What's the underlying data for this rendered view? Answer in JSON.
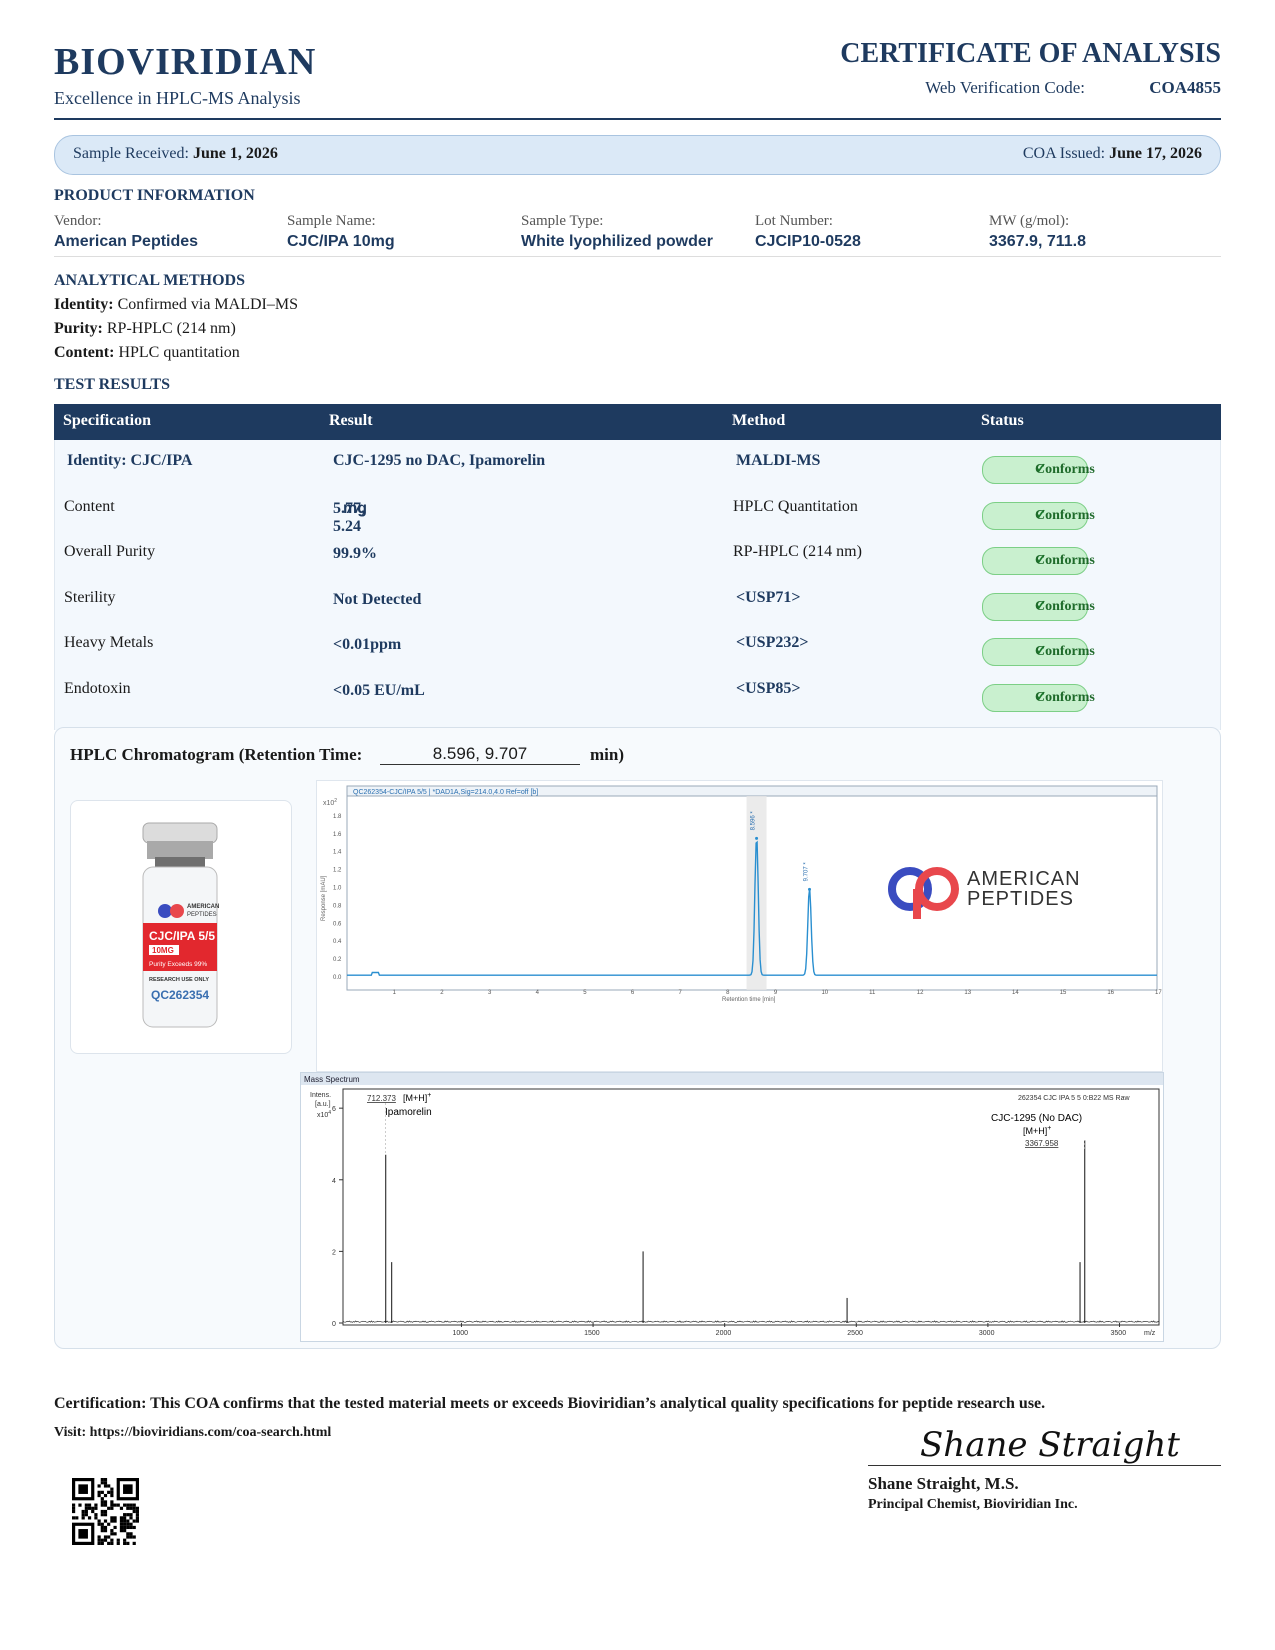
{
  "header": {
    "brand": "BIOVIRIDIAN",
    "tagline": "Excellence in HPLC-MS Analysis",
    "doc_title": "CERTIFICATE OF ANALYSIS",
    "verification_label": "Web Verification Code:",
    "verification_code": "COA4855"
  },
  "dates": {
    "received_label": "Sample Received:",
    "received_value": "June 1, 2026",
    "issued_label": "COA Issued:",
    "issued_value": "June 17, 2026"
  },
  "product": {
    "heading": "PRODUCT INFORMATION",
    "fields": [
      {
        "label": "Vendor:",
        "value": "American Peptides"
      },
      {
        "label": "Sample Name:",
        "value": "CJC/IPA 10mg"
      },
      {
        "label": "Sample Type:",
        "value": "White lyophilized powder"
      },
      {
        "label": "Lot Number:",
        "value": "CJCIP10-0528"
      },
      {
        "label": "MW (g/mol):",
        "value": "3367.9, 711.8"
      }
    ]
  },
  "methods": {
    "heading": "ANALYTICAL METHODS",
    "lines": [
      {
        "label": "Identity:",
        "value": "Confirmed via MALDI–MS"
      },
      {
        "label": "Purity:",
        "value": "RP-HPLC (214 nm)"
      },
      {
        "label": "Content:",
        "value": "HPLC quantitation"
      }
    ]
  },
  "results": {
    "heading": "TEST RESULTS",
    "columns": [
      "Specification",
      "Result",
      "Method",
      "Status"
    ],
    "rows": [
      {
        "spec": "Identity:  CJC/IPA",
        "result": "CJC-1295 no DAC, Ipamorelin",
        "method": "MALDI-MS",
        "status": "Conforms"
      },
      {
        "spec": "Content",
        "result": "5.77, 5.24",
        "unit": "mg",
        "method": "HPLC Quantitation",
        "status": "Conforms"
      },
      {
        "spec": "Overall Purity",
        "result": "99.9%",
        "method": "RP-HPLC (214 nm)",
        "status": "Conforms"
      },
      {
        "spec": "Sterility",
        "result": "Not Detected",
        "method": "<USP71>",
        "status": "Conforms"
      },
      {
        "spec": "Heavy Metals",
        "result": "<0.01ppm",
        "method": "<USP232>",
        "status": "Conforms"
      },
      {
        "spec": "Endotoxin",
        "result": "<0.05 EU/mL",
        "method": "<USP85>",
        "status": "Conforms"
      }
    ]
  },
  "chromatogram": {
    "title": "HPLC Chromatogram (Retention Time:",
    "retention_value": "8.596, 9.707",
    "retention_unit": "min)"
  },
  "vial": {
    "brand_top": "AMERICAN",
    "brand_bottom": "PEPTIDES",
    "product": "CJC/IPA 5/5",
    "dose": "10MG",
    "purity": "Purity Exceeds 99%",
    "use": "RESEARCH USE ONLY",
    "lot": "QC262354"
  },
  "hplc_plot": {
    "trace_title": "QC262354-CJC/IPA 5/5 | *DAD1A,Sig=214.0,4.0 Ref=off [b]",
    "y_multiplier": "x10",
    "y_exp": "2",
    "y_axis_label": "Response [mAU]",
    "x_axis_label": "Retention time [min]",
    "peak_labels": [
      "8.596 *",
      "9.707 *"
    ],
    "logo_top": "AMERICAN",
    "logo_bottom": "PEPTIDES"
  },
  "ms_plot": {
    "panel_title": "Mass Spectrum",
    "y_label_1": "Intens.",
    "y_label_2": "[a.u.]",
    "y_multiplier": "x10",
    "y_exp": "4",
    "file_label": "262354 CJC IPA 5 5 0:B22 MS Raw",
    "peak1_mz": "712.373",
    "peak1_ion": "[M+H]",
    "peak1_name": "Ipamorelin",
    "peak2_name": "CJC-1295 (No DAC)",
    "peak2_ion": "[M+H]",
    "peak2_mz": "3367.958",
    "x_unit": "m/z"
  },
  "chart_data": [
    {
      "type": "line",
      "title": "QC262354-CJC/IPA 5/5 | *DAD1A,Sig=214.0,4.0 Ref=off [b]",
      "xlabel": "Retention time [min]",
      "ylabel": "Response [mAU]",
      "xlim": [
        0,
        17
      ],
      "ylim": [
        0,
        1.9
      ],
      "x_ticks": [
        1,
        2,
        3,
        4,
        5,
        6,
        7,
        8,
        9,
        10,
        11,
        12,
        13,
        14,
        15,
        16,
        17
      ],
      "y_ticks": [
        0.0,
        0.2,
        0.4,
        0.6,
        0.8,
        1.0,
        1.2,
        1.4,
        1.6,
        1.8
      ],
      "y_tick_labels": [
        "0.0",
        "0.2",
        "0.4",
        "0.6",
        "0.8",
        "1.0",
        "1.2",
        "1.4",
        "1.6",
        "1.8"
      ],
      "peaks": [
        {
          "x": 8.596,
          "y": 1.55,
          "label": "8.596 *"
        },
        {
          "x": 9.707,
          "y": 0.98,
          "label": "9.707 *"
        }
      ]
    },
    {
      "type": "line",
      "title": "Mass Spectrum",
      "xlabel": "m/z",
      "ylabel": "Intens. [a.u.]",
      "xlim": [
        550,
        3650
      ],
      "ylim": [
        0,
        6.2
      ],
      "x_ticks": [
        1000,
        1500,
        2000,
        2500,
        3000,
        3500
      ],
      "y_ticks": [
        0,
        2,
        4,
        6
      ],
      "peaks": [
        {
          "x": 712.373,
          "y": 4.7
        },
        {
          "x": 735,
          "y": 1.7
        },
        {
          "x": 1690,
          "y": 2.0
        },
        {
          "x": 2465,
          "y": 0.7
        },
        {
          "x": 3350,
          "y": 1.7
        },
        {
          "x": 3367.958,
          "y": 5.1
        }
      ]
    }
  ],
  "certification": {
    "statement": "Certification: This COA confirms that the tested material meets or exceeds Bioviridian’s analytical quality specifications for peptide research use.",
    "visit": "Visit: https://bioviridians.com/coa-search.html"
  },
  "signature": {
    "script": "Shane Straight",
    "name": "Shane Straight, M.S.",
    "title": "Principal Chemist, Bioviridian Inc."
  },
  "colors": {
    "navy": "#1e3a5f",
    "badge_bg": "#c9f0cf",
    "trace": "#2a8fd0",
    "logo_blue": "#3a4cc0",
    "logo_red": "#e8474c"
  }
}
